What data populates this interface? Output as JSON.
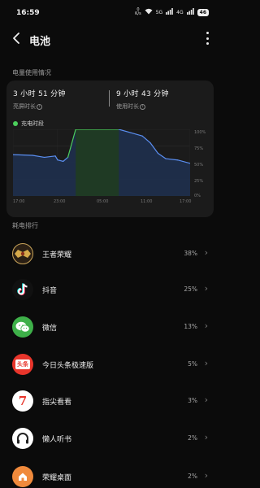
{
  "status_bar": {
    "time": "16:59",
    "net_speed_value": "0",
    "net_speed_unit": "K/s",
    "signal_1": "5G",
    "signal_2": "4G",
    "battery_level": "46"
  },
  "header": {
    "title": "电池"
  },
  "usage_section": {
    "label": "电量使用情况",
    "screen_on": {
      "value": "3 小时 51 分钟",
      "label": "亮屏时长"
    },
    "usage_time": {
      "value": "9 小时 43 分钟",
      "label": "使用时长"
    },
    "legend_label": "充电时段"
  },
  "chart_data": {
    "type": "line",
    "x_tick_labels": [
      "17:00",
      "23:00",
      "05:00",
      "11:00",
      "17:00"
    ],
    "y_tick_labels": [
      "100%",
      "75%",
      "50%",
      "25%",
      "0%"
    ],
    "ylim": [
      0,
      100
    ],
    "series": [
      {
        "values": [
          [
            0,
            62
          ],
          [
            2.5,
            61
          ],
          [
            4,
            58
          ],
          [
            5.4,
            60
          ],
          [
            5.7,
            54
          ],
          [
            6.4,
            52
          ],
          [
            7,
            58
          ],
          [
            8,
            100
          ],
          [
            13.5,
            100
          ],
          [
            15,
            95
          ],
          [
            16.5,
            90
          ],
          [
            17.5,
            80
          ],
          [
            18.5,
            64
          ],
          [
            19.5,
            56
          ],
          [
            21,
            54
          ],
          [
            22.6,
            49
          ]
        ]
      }
    ],
    "charging_periods": [
      [
        8,
        13.5
      ]
    ],
    "x_range": [
      0,
      22.6
    ],
    "colors": {
      "line": "#5b8ff2",
      "fill": "#1e3050",
      "charging_line": "#4ccf5c",
      "charging_fill": "#1f3a24"
    }
  },
  "apps_section": {
    "label": "耗电排行",
    "apps": [
      {
        "name": "王者荣耀",
        "percent": "38%",
        "icon": "honor-of-kings-icon"
      },
      {
        "name": "抖音",
        "percent": "25%",
        "icon": "douyin-icon"
      },
      {
        "name": "微信",
        "percent": "13%",
        "icon": "wechat-icon"
      },
      {
        "name": "今日头条极速版",
        "percent": "5%",
        "icon": "toutiao-icon",
        "icon_text": "头条"
      },
      {
        "name": "指尖看看",
        "percent": "3%",
        "icon": "zhijian-icon",
        "icon_text": "7"
      },
      {
        "name": "懒人听书",
        "percent": "2%",
        "icon": "lazy-audio-icon"
      },
      {
        "name": "荣耀桌面",
        "percent": "2%",
        "icon": "honor-launcher-icon"
      }
    ]
  }
}
